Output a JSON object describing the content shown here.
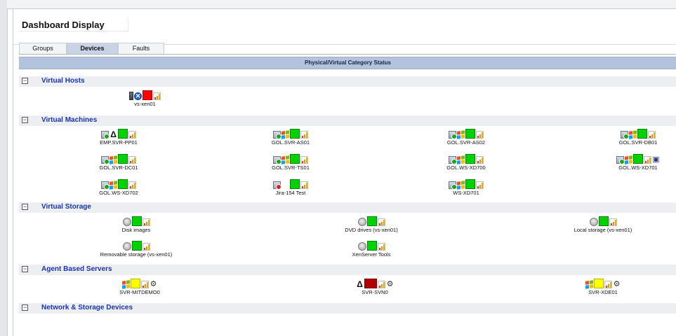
{
  "header": {
    "title": "Dashboard Display"
  },
  "tabs": [
    {
      "label": "Groups",
      "active": false
    },
    {
      "label": "Devices",
      "active": true
    },
    {
      "label": "Faults",
      "active": false
    }
  ],
  "category_header": "Physical/Virtual Category Status",
  "sections": {
    "virtual_hosts": {
      "title": "Virtual Hosts",
      "items": [
        {
          "label": "vs-xen01",
          "status": "red",
          "icons": [
            "server-icon",
            "xen-icon",
            "chart-icon"
          ]
        }
      ]
    },
    "virtual_machines": {
      "title": "Virtual Machines",
      "items": [
        {
          "label": "EMP.SVR-PP01",
          "status": "green"
        },
        {
          "label": "GOL.SVR-AS01",
          "status": "green"
        },
        {
          "label": "GOL.SVR-AS02",
          "status": "green"
        },
        {
          "label": "GOL.SVR-DB01",
          "status": "green"
        },
        {
          "label": "GOL.SVR-DC01",
          "status": "green"
        },
        {
          "label": "GOL.SVR-TS01",
          "status": "green"
        },
        {
          "label": "GOL.WS-XD700",
          "status": "green"
        },
        {
          "label": "GOL.WS-XD701",
          "status": "green"
        },
        {
          "label": "GOL.WS-XD702",
          "status": "green"
        },
        {
          "label": "Jira-154 Test",
          "status": "green"
        },
        {
          "label": "WS-XD701",
          "status": "green"
        }
      ]
    },
    "virtual_storage": {
      "title": "Virtual Storage",
      "items": [
        {
          "label": "Disk images",
          "status": "green"
        },
        {
          "label": "DVD drives (vs-xen01)",
          "status": "green"
        },
        {
          "label": "Local storage (vs-xen01)",
          "status": "green"
        },
        {
          "label": "Removable storage (vs-xen01)",
          "status": "green"
        },
        {
          "label": "XenServer Tools",
          "status": "green"
        }
      ]
    },
    "agent_servers": {
      "title": "Agent Based Servers",
      "items": [
        {
          "label": "SVR-MITDEMO0",
          "status": "yellow"
        },
        {
          "label": "SVR-SVN0",
          "status": "dark-red"
        },
        {
          "label": "SVR-XDE01",
          "status": "yellow"
        }
      ]
    },
    "network_storage": {
      "title": "Network & Storage Devices",
      "items": []
    }
  },
  "colors": {
    "ok": "#00d200",
    "critical": "#ff0000",
    "warning": "#ffff00",
    "down": "#b00000",
    "section_title": "#1733b8",
    "header_bar": "#b3c3de"
  }
}
